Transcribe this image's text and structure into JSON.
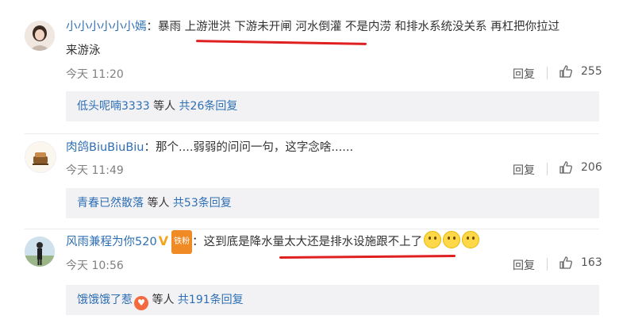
{
  "comments": [
    {
      "username": "小小小小小小嫣",
      "text_line1": "：暴雨 上游泄洪 下游未开闸 河水倒灌 不是内涝 和排水系统没关系  再杠把你拉过",
      "text_line2": "来游泳",
      "time": "今天 11:20",
      "reply_label": "回复",
      "likes": "255",
      "sub_user": "低头呢喃3333",
      "sub_mid": " 等人 ",
      "sub_count": "共26条回复"
    },
    {
      "username": "肉鸽BiuBiuBiu",
      "text_line1": "：那个....弱弱的问问一句，这字念啥......",
      "time": "今天 11:49",
      "reply_label": "回复",
      "likes": "206",
      "sub_user": "青春已然散落",
      "sub_mid": " 等人 ",
      "sub_count": "共53条回复"
    },
    {
      "username": "风雨兼程为你520",
      "fan_badge": "铁粉",
      "text_line1": "：这到底是降水量太大还是排水设施跟不上了",
      "time": "今天 10:56",
      "reply_label": "回复",
      "likes": "163",
      "sub_user": "饿饿饿了惹",
      "sub_mid": " 等人 ",
      "sub_count": "共191条回复"
    }
  ],
  "colors": {
    "link": "#2e6fb4",
    "annotation": "#e02020",
    "subbox": "#f2f2f5"
  },
  "icons": [
    "like-thumb-icon",
    "verified-v-icon",
    "smile-emoji-icon",
    "heart-badge-icon"
  ]
}
